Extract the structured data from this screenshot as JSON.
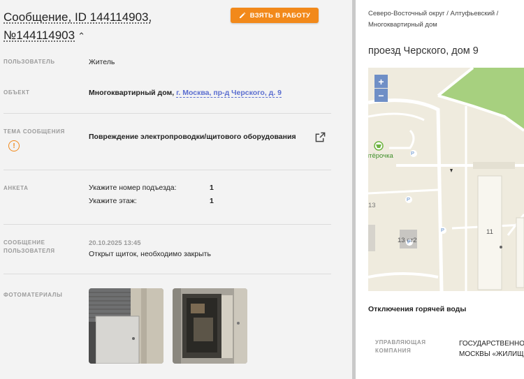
{
  "message": {
    "title_line1": "Сообщение, ID 144114903,",
    "title_line2": "№144114903",
    "take_button": "ВЗЯТЬ В РАБОТУ"
  },
  "fields": {
    "user_label": "ПОЛЬЗОВАТЕЛЬ",
    "user_value": "Житель",
    "object_label": "ОБЪЕКТ",
    "object_type": "Многоквартирный дом,",
    "object_link": "г. Москва, пр-д Черского, д. 9",
    "topic_label": "ТЕМА СООБЩЕНИЯ",
    "topic_value": "Повреждение электропроводки/щитового оборудования",
    "survey_label": "АНКЕТА",
    "survey": [
      {
        "question": "Укажите номер подъезда:",
        "answer": "1"
      },
      {
        "question": "Укажите этаж:",
        "answer": "1"
      }
    ],
    "usermsg_label_1": "СООБЩЕНИЕ",
    "usermsg_label_2": "ПОЛЬЗОВАТЕЛЯ",
    "usermsg_date": "20.10.2025 13:45",
    "usermsg_text": "Открыт щиток, необходимо закрыть",
    "photos_label": "ФОТОМАТЕРИАЛЫ"
  },
  "right": {
    "breadcrumb_1": "Северо-Восточный округ / Алтуфьевский /",
    "breadcrumb_2": "Многоквартирный дом",
    "address": "проезд Черского, дом 9",
    "map": {
      "zoom_in": "+",
      "zoom_out": "−",
      "shop_label": "ятёрочка",
      "labels": [
        "13",
        "13 ст2",
        "11"
      ],
      "parking": "P"
    },
    "hot_water_title": "Отключения горячей воды",
    "mc_label_1": "УПРАВЛЯЮЩАЯ",
    "mc_label_2": "КОМПАНИЯ",
    "mc_value_1": "ГОСУДАРСТВЕННОЕ",
    "mc_value_2": "МОСКВЫ «ЖИЛИЩ"
  },
  "colors": {
    "accent": "#f2891a",
    "link": "#5b6ed0",
    "map_bg": "#efebde",
    "map_park": "#a7d07f",
    "zoom": "#6f8fc6"
  }
}
